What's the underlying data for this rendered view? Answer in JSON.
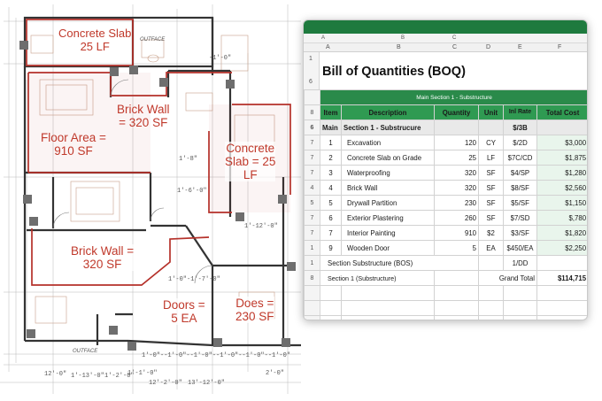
{
  "plan": {
    "labels": {
      "concrete_slab_top": "Concrete Slab\n25 LF",
      "outface_top": "OUTFACE",
      "brick_wall_top": "Brick Wall\n= 320 SF",
      "floor_area": "Floor Area =\n910 SF",
      "concrete_slab_mid": "Concrete\nSlab = 25\nLF",
      "brick_wall_bottom": "Brick Wall =\n320 SF",
      "doors": "Doors =\n5 EA",
      "does": "Does =\n230 SF",
      "outface_bottom": "OUTFACE"
    },
    "dimensions": {
      "d1": "1'-8\"",
      "d2": "1'-6'-0\"",
      "d3": "1'-12'-0\"",
      "d4": "1'-0\"-1'-7'-0\"",
      "d5": "-1'-0\"",
      "d6": "12'-0\"",
      "d7": "1'-13'-0\"",
      "d8": "1'-2'-0\"",
      "d9": "12'-2'-0\"",
      "d10": "13'-12'-0\"",
      "d11": "1'-0\"--1'-0\"--1'-0\"--1'-0\"--1'-0\"--1'-0\"",
      "d12": "1'-1'-0\"",
      "d13": "2'-0\""
    }
  },
  "sheet": {
    "toolbar": {
      "cell_ref": "A",
      "col_b": "B",
      "col_c": "C"
    },
    "col_headers": [
      "A",
      "B",
      "C",
      "D",
      "E",
      "F"
    ],
    "title_row_nums": [
      "1",
      "6"
    ],
    "title": "Bill of Quantities (BOQ)",
    "banner_row_num": "",
    "banner": "Main Section 1 - Substructure",
    "header_row_num": "8",
    "headers": {
      "item": "Item",
      "description": "Description",
      "quantity": "Quantity",
      "unit": "Unit",
      "rate": "Inl Rate",
      "total": "Total Cost"
    },
    "section_row": {
      "rn": "6",
      "item": "Main",
      "description": "Section 1 - Substrucure",
      "rate": "$/3B"
    },
    "rows": [
      {
        "rn": "7",
        "item": "1",
        "description": "Excavation",
        "quantity": "120",
        "unit": "CY",
        "rate": "$/2D",
        "total": "$3,000"
      },
      {
        "rn": "7",
        "item": "2",
        "description": "Concrete Slab on Grade",
        "quantity": "25",
        "unit": "LF",
        "rate": "$7C/CD",
        "total": "$1,875"
      },
      {
        "rn": "7",
        "item": "3",
        "description": "Waterproofing",
        "quantity": "320",
        "unit": "SF",
        "rate": "$4/SP",
        "total": "$1,280"
      },
      {
        "rn": "4",
        "item": "4",
        "description": "Brick Wall",
        "quantity": "320",
        "unit": "SF",
        "rate": "$8/SF",
        "total": "$2,560"
      },
      {
        "rn": "5",
        "item": "5",
        "description": "Drywall Partition",
        "quantity": "230",
        "unit": "SF",
        "rate": "$5/SF",
        "total": "$1,150"
      },
      {
        "rn": "7",
        "item": "6",
        "description": "Exterior Plastering",
        "quantity": "260",
        "unit": "SF",
        "rate": "$7/SD",
        "total": "$,780"
      },
      {
        "rn": "7",
        "item": "7",
        "description": "Interior Painting",
        "quantity": "910",
        "unit": "$2",
        "rate": "$3/SF",
        "total": "$1,820"
      },
      {
        "rn": "1",
        "item": "9",
        "description": "Wooden Door",
        "quantity": "5",
        "unit": "EA",
        "rate": "$450/EA",
        "total": "$2,250"
      }
    ],
    "subtotal_row": {
      "rn": "1",
      "description": "Section Substructure (BOS)",
      "rate": "1/DD"
    },
    "total_row": {
      "rn": "8",
      "description": "Section 1 (Substructure)",
      "label": "Grand Total",
      "value": "$114,715"
    },
    "empty_row_nums": [
      "",
      "",
      "",
      ""
    ]
  }
}
